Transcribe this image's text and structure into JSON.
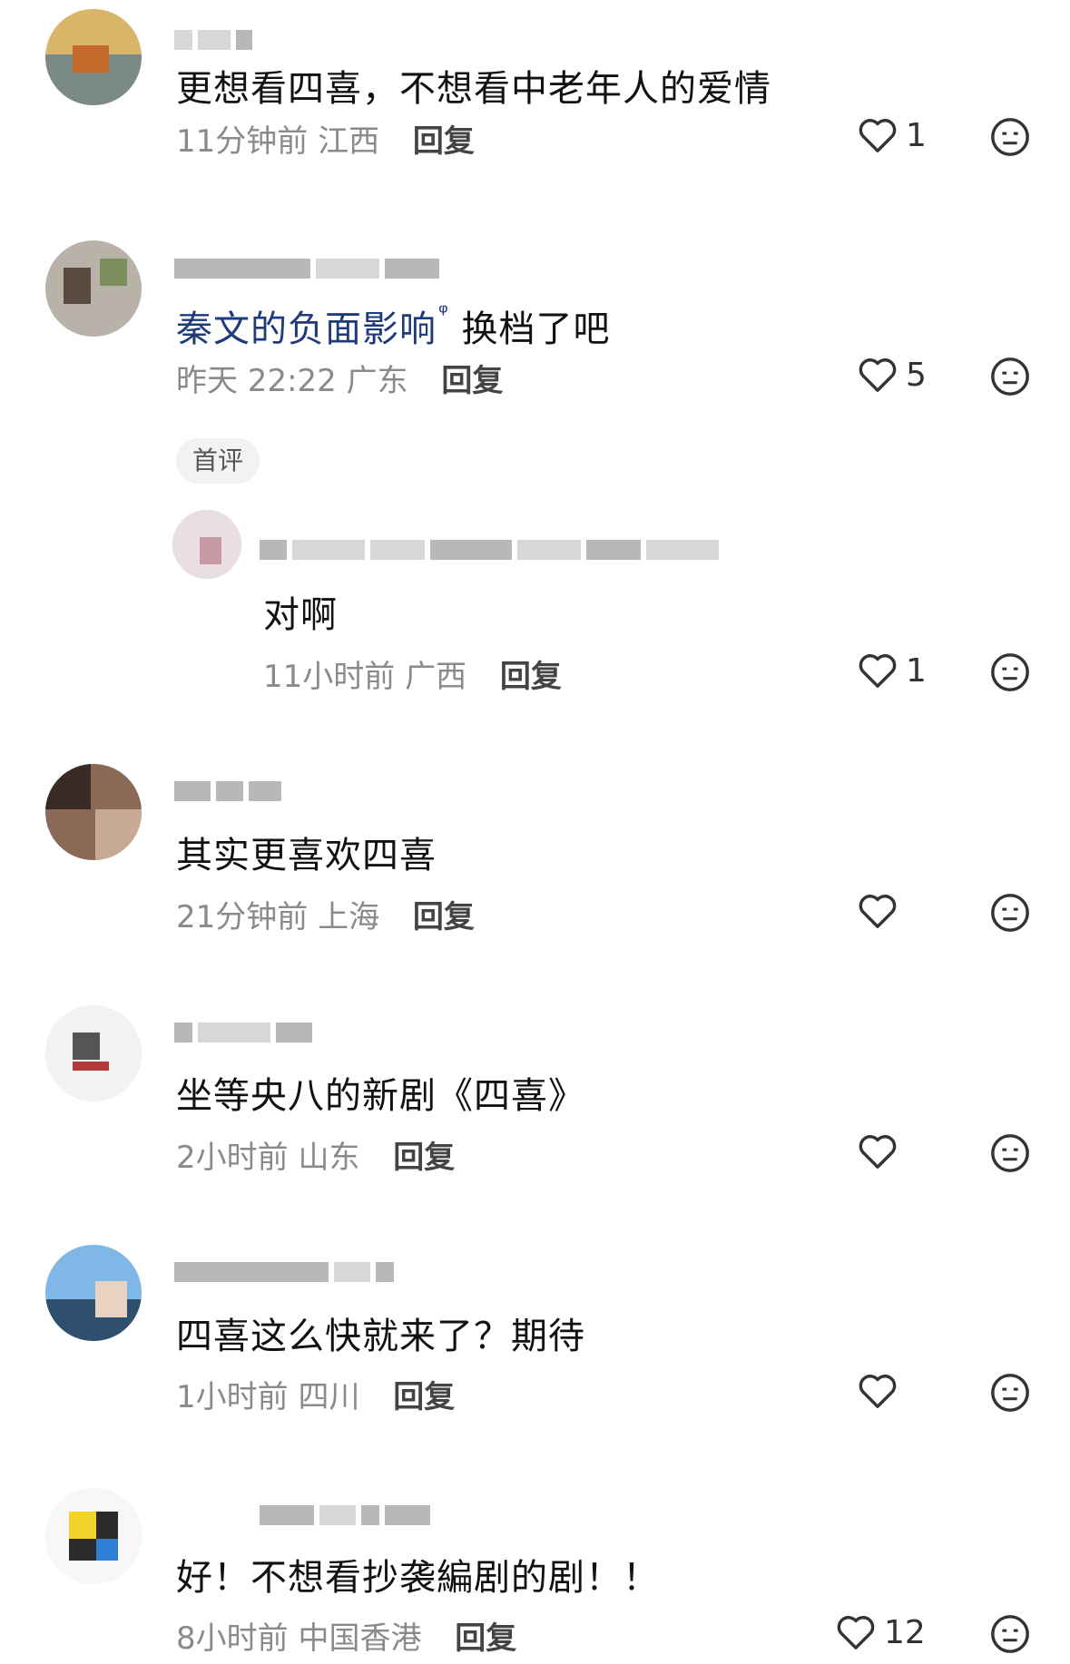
{
  "comments": [
    {
      "text": "更想看四喜，不想看中老年人的爱情",
      "time_location": "11分钟前 江西",
      "reply_label": "回复",
      "likes": "1"
    },
    {
      "text_link": "秦文的负面影响",
      "link_icon": "ᵠ",
      "text_rest": " 换档了吧",
      "time_location": "昨天 22:22 广东",
      "reply_label": "回复",
      "likes": "5",
      "badge": "首评"
    },
    {
      "text": "对啊",
      "time_location": "11小时前 广西",
      "reply_label": "回复",
      "likes": "1"
    },
    {
      "text": "其实更喜欢四喜",
      "time_location": "21分钟前 上海",
      "reply_label": "回复",
      "likes": ""
    },
    {
      "text": "坐等央八的新剧《四喜》",
      "time_location": "2小时前 山东",
      "reply_label": "回复",
      "likes": ""
    },
    {
      "text": "四喜这么快就来了？期待",
      "time_location": "1小时前 四川",
      "reply_label": "回复",
      "likes": ""
    },
    {
      "text": "好！不想看抄袭編剧的剧！！",
      "time_location": "8小时前 中国香港",
      "reply_label": "回复",
      "likes": "12"
    }
  ],
  "icons": {
    "like": "heart-outline-icon",
    "dislike": "neutral-face-icon"
  },
  "colors": {
    "text": "#111111",
    "meta": "#8a8a8a",
    "link": "#1f3b7a"
  }
}
